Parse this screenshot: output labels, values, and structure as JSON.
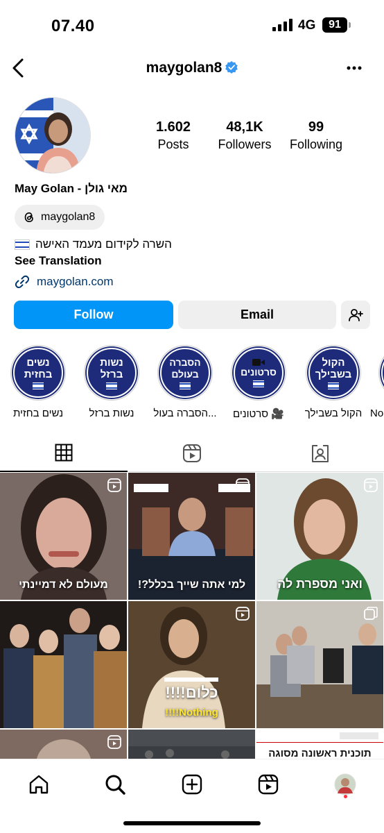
{
  "status_bar": {
    "time": "07.40",
    "network": "4G",
    "battery": "91"
  },
  "header": {
    "username": "maygolan8",
    "verified_color": "#3897f0"
  },
  "stats": [
    {
      "value": "1.602",
      "label": "Posts"
    },
    {
      "value": "48,1K",
      "label": "Followers"
    },
    {
      "value": "99",
      "label": "Following"
    }
  ],
  "profile": {
    "display_name": "May Golan - מאי גולן",
    "threads_handle": "maygolan8",
    "bio": "השרה לקידום מעמד האישה",
    "see_translation": "See Translation",
    "link": "maygolan.com"
  },
  "actions": {
    "follow": "Follow",
    "email": "Email",
    "follow_color": "#0095f6"
  },
  "highlights": [
    {
      "title_lines": [
        "נשים",
        "בחזית"
      ],
      "caption": "נשים בחזית"
    },
    {
      "title_lines": [
        "נשות",
        "ברזל"
      ],
      "caption": "נשות ברזל"
    },
    {
      "title_lines": [
        "הסברה",
        "בעולם"
      ],
      "caption": "הסברה בעול..."
    },
    {
      "title_lines": [
        "סרטונים"
      ],
      "caption": "סרטונים 🎥"
    },
    {
      "title_lines": [
        "הקול",
        "בשבילך"
      ],
      "caption": "הקול בשבילך"
    },
    {
      "title_lines": [
        ""
      ],
      "caption": "No"
    }
  ],
  "grid": {
    "cells": [
      {
        "caption": "מעולם לא דמיינתי"
      },
      {
        "caption": "למי אתה שייך בכלל?!"
      },
      {
        "caption": "ואני מספרת לה"
      },
      {
        "caption": ""
      },
      {
        "caption": "כלום!!!!",
        "subcaption": "Nothing!!!!"
      },
      {
        "caption": ""
      },
      {
        "caption": ""
      },
      {
        "caption": ""
      },
      {
        "caption": "תוכנית ראשונה מסוגה לתמיכה"
      }
    ]
  },
  "icons": {
    "back": "back-arrow-icon",
    "more": "more-dots-icon",
    "threads": "threads-icon",
    "link": "link-icon",
    "add_person": "add-person-icon",
    "grid_tab": "grid-icon",
    "reels_tab": "reels-icon",
    "tagged_tab": "tagged-icon",
    "home": "home-icon",
    "search": "search-icon",
    "create": "create-icon",
    "reels": "reels-icon"
  }
}
